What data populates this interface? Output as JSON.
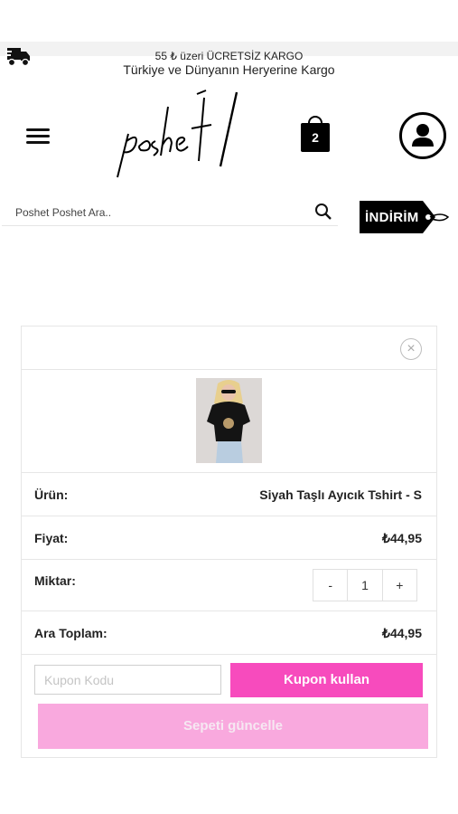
{
  "header": {
    "shipping_line1": "55 ₺ üzeri ÜCRETSİZ KARGO",
    "shipping_line2": "Türkiye ve Dünyanın Heryerine Kargo",
    "logo_text": "poshet",
    "cart_count": "2",
    "search_placeholder": "Poshet Poshet Ara..",
    "sale_tag": "İNDİRİM"
  },
  "cart": {
    "close_symbol": "×",
    "product_label": "Ürün:",
    "product_name": "Siyah Taşlı Ayıcık Tshirt - S",
    "price_label": "Fiyat:",
    "price": "₺44,95",
    "quantity_label": "Miktar:",
    "qty_minus": "-",
    "quantity": "1",
    "qty_plus": "+",
    "subtotal_label": "Ara Toplam:",
    "subtotal": "₺44,95",
    "coupon_placeholder": "Kupon Kodu",
    "coupon_button": "Kupon kullan",
    "update_button": "Sepeti güncelle"
  },
  "colors": {
    "accent_pink": "#f74bbd",
    "light_pink": "#f9a9de",
    "dark": "#000000"
  },
  "icons": [
    "truck-icon",
    "hamburger-menu-icon",
    "shopping-bag-icon",
    "user-account-icon",
    "search-icon",
    "sale-tag-icon",
    "close-icon"
  ]
}
